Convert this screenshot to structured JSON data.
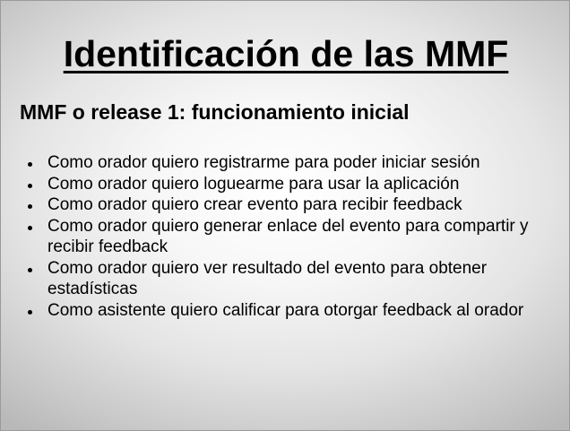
{
  "slide": {
    "title": "Identificación de las MMF",
    "subtitle": "MMF o release 1: funcionamiento inicial",
    "bullets": [
      "Como orador quiero registrarme para poder iniciar sesión",
      "Como orador quiero loguearme para usar la aplicación",
      "Como orador quiero crear evento para recibir feedback",
      "Como orador quiero generar enlace del evento para compartir y recibir feedback",
      "Como orador quiero ver resultado del evento para obtener estadísticas",
      "Como asistente quiero calificar para otorgar feedback al orador"
    ]
  }
}
